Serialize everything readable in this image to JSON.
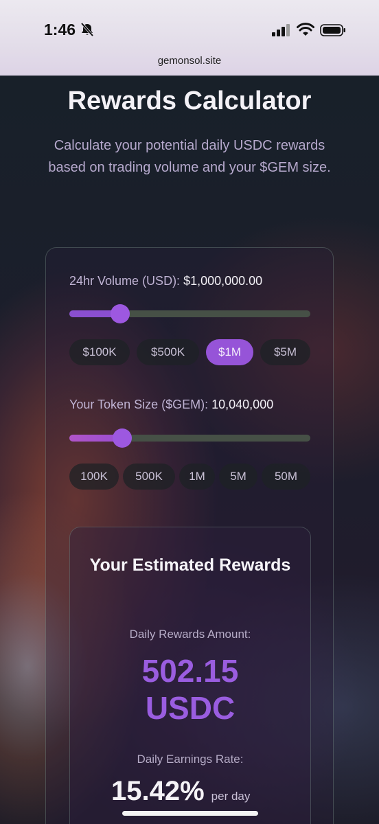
{
  "status_bar": {
    "time": "1:46"
  },
  "browser": {
    "url": "gemonsol.site"
  },
  "header": {
    "title": "Rewards Calculator",
    "subtitle": "Calculate your potential daily USDC rewards based on trading volume and your $GEM size."
  },
  "volume": {
    "label": "24hr Volume (USD):",
    "value": "$1,000,000.00",
    "slider_fraction": 0.21,
    "presets": [
      "$100K",
      "$500K",
      "$1M",
      "$5M"
    ],
    "active_preset": "$1M"
  },
  "token": {
    "label": "Your Token Size ($GEM):",
    "value": "10,040,000",
    "slider_fraction": 0.22,
    "presets": [
      "100K",
      "500K",
      "1M",
      "5M",
      "50M"
    ]
  },
  "results": {
    "title": "Your Estimated Rewards",
    "daily_label": "Daily Rewards Amount:",
    "amount_number": "502.15",
    "amount_unit": "USDC",
    "rate_label": "Daily Earnings Rate:",
    "rate": "15.42%",
    "rate_suffix": "per day"
  },
  "colors": {
    "accent": "#9654d8",
    "slider_track": "#465046",
    "background": "#1b1d27"
  }
}
